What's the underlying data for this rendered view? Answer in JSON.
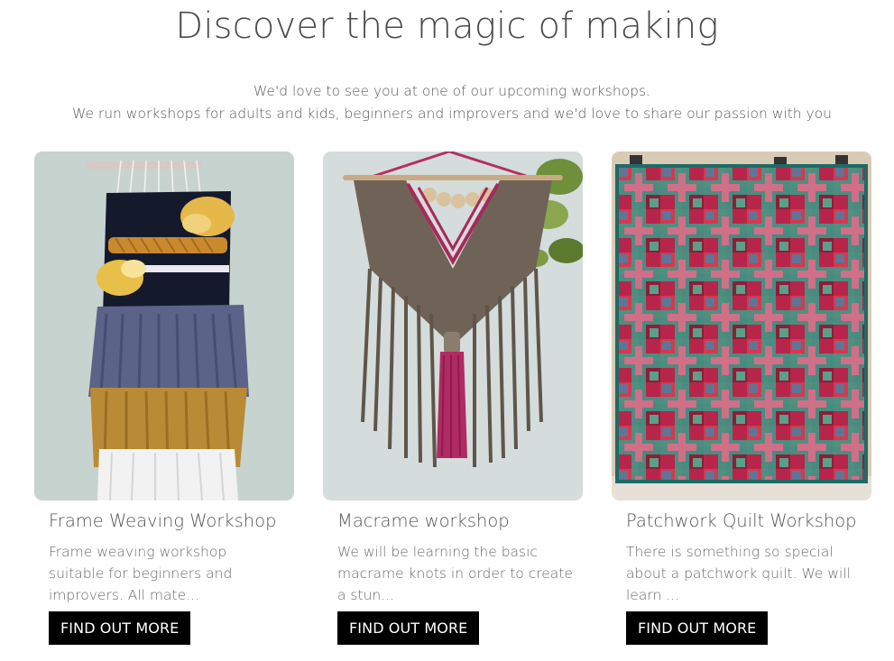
{
  "header": {
    "title": "Discover the magic of making",
    "intro_line1": "We'd love to see you at one of our upcoming workshops.",
    "intro_line2": "We run workshops for adults and kids, beginners and improvers and we'd love to share our passion with you"
  },
  "workshops": [
    {
      "title": "Frame Weaving Workshop",
      "description": "Frame weaving workshop suitable for beginners and improvers. All mate...",
      "button_label": "FIND OUT MORE",
      "image": "woven-wall-hanging-photo"
    },
    {
      "title": "Macrame workshop",
      "description": "We will be learning the basic macrame knots in order to create a stun...",
      "button_label": "FIND OUT MORE",
      "image": "macrame-wall-hanging-photo"
    },
    {
      "title": "Patchwork Quilt Workshop",
      "description": "There is something so special about a patchwork quilt. We will learn ...",
      "button_label": "FIND OUT MORE",
      "image": "patchwork-quilt-photo"
    }
  ],
  "colors": {
    "button_bg": "#000000",
    "button_text": "#ffffff",
    "heading": "#4a4a4a",
    "body_text": "#5a5a5a"
  }
}
